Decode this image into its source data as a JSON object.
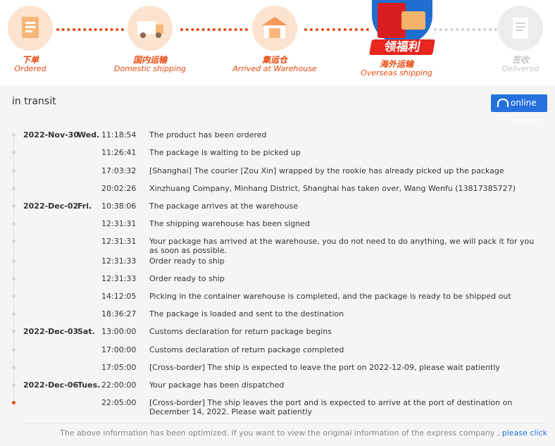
{
  "steps": [
    {
      "cn": "下单",
      "en": "Ordered"
    },
    {
      "cn": "国内运输",
      "en": "Domestic shipping"
    },
    {
      "cn": "集运仓",
      "en": "Arrived at Warehouse"
    },
    {
      "cn": "海外运输",
      "en": "Overseas shipping"
    },
    {
      "cn": "签收",
      "en": "Delivered"
    }
  ],
  "promo": {
    "label": "领福利"
  },
  "status": {
    "title": "in transit"
  },
  "service": {
    "button_label": "online",
    "sub_label": "service"
  },
  "events": [
    {
      "date": "2022-Nov-30",
      "weekday": "Wed.",
      "time": "11:18:54",
      "desc": "The product has been ordered"
    },
    {
      "date": "",
      "weekday": "",
      "time": "11:26:41",
      "desc": "The package is waiting to be picked up"
    },
    {
      "date": "",
      "weekday": "",
      "time": "17:03:32",
      "desc": "[Shanghai] The courier [Zou Xin] wrapped by the rookie has already picked up the package"
    },
    {
      "date": "",
      "weekday": "",
      "time": "20:02:26",
      "desc": "Xinzhuang Company, Minhang District, Shanghai has taken over, Wang Wenfu (13817385727)"
    },
    {
      "date": "2022-Dec-02",
      "weekday": "Fri.",
      "time": "10:38:06",
      "desc": "The package arrives at the warehouse"
    },
    {
      "date": "",
      "weekday": "",
      "time": "12:31:31",
      "desc": "The shipping warehouse has been signed"
    },
    {
      "date": "",
      "weekday": "",
      "time": "12:31:31",
      "desc": "Your package has arrived at the warehouse, you do not need to do anything, we will pack it for you as soon as possible."
    },
    {
      "date": "",
      "weekday": "",
      "time": "12:31:33",
      "desc": "Order ready to ship"
    },
    {
      "date": "",
      "weekday": "",
      "time": "12:31:33",
      "desc": "Order ready to ship"
    },
    {
      "date": "",
      "weekday": "",
      "time": "14:12:05",
      "desc": "Picking in the container warehouse is completed, and the package is ready to be shipped out"
    },
    {
      "date": "",
      "weekday": "",
      "time": "18:36:27",
      "desc": "The package is loaded and sent to the destination"
    },
    {
      "date": "2022-Dec-03",
      "weekday": "Sat.",
      "time": "13:00:00",
      "desc": "Customs declaration for return package begins"
    },
    {
      "date": "",
      "weekday": "",
      "time": "17:00:00",
      "desc": "Customs declaration of return package completed"
    },
    {
      "date": "",
      "weekday": "",
      "time": "17:05:00",
      "desc": "[Cross-border] The ship is expected to leave the port on 2022-12-09, please wait patiently"
    },
    {
      "date": "2022-Dec-06",
      "weekday": "Tues.",
      "time": "22:00:00",
      "desc": "Your package has been dispatched"
    },
    {
      "date": "",
      "weekday": "",
      "time": "22:05:00",
      "desc": "[Cross-border] The ship leaves the port and is expected to arrive at the port of destination on December 14, 2022. Please wait patiently"
    }
  ],
  "footer": {
    "note": "The above information has been optimized. If you want to view the original information of the express company ,",
    "link": "please click"
  },
  "colors": {
    "accent": "#e8490f",
    "button": "#2671dd",
    "panel": "#f5f5f5"
  }
}
